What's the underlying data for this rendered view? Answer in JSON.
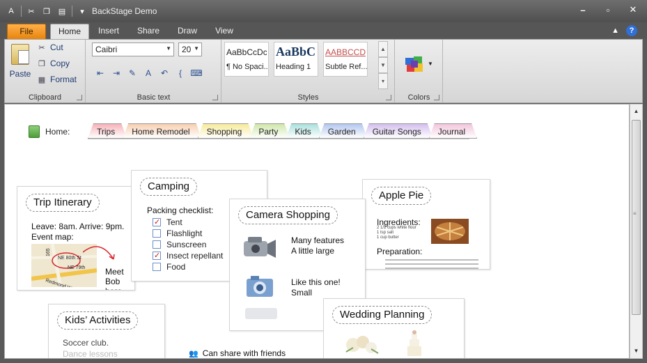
{
  "window": {
    "title": "BackStage Demo"
  },
  "qat": {
    "icons": [
      "app-icon",
      "cut-icon",
      "copy-icon",
      "paste-icon",
      "customize-icon"
    ]
  },
  "tabs": [
    "File",
    "Home",
    "Insert",
    "Share",
    "Draw",
    "View"
  ],
  "ribbon": {
    "clipboard": {
      "paste": "Paste",
      "cut": "Cut",
      "copy": "Copy",
      "format": "Format",
      "label": "Clipboard"
    },
    "basic_text": {
      "font": "Caibri",
      "size": "20",
      "label": "Basic text"
    },
    "styles": {
      "items": [
        {
          "preview": "AaBbCcDc",
          "name": "¶ No Spaci..."
        },
        {
          "preview": "AaBbC",
          "name": "Heading 1"
        },
        {
          "preview": "AABBCCDD",
          "name": "Subtle Ref..."
        }
      ],
      "label": "Styles"
    },
    "colors": {
      "label": "Colors"
    }
  },
  "notebook": {
    "home_label": "Home:",
    "sections": [
      {
        "name": "Trips",
        "color": "#f6b3b9"
      },
      {
        "name": "Home Remodel",
        "color": "#f8cfb0"
      },
      {
        "name": "Shopping",
        "color": "#f7ea9a"
      },
      {
        "name": "Party",
        "color": "#cfe7a9"
      },
      {
        "name": "Kids",
        "color": "#a9e0dd"
      },
      {
        "name": "Garden",
        "color": "#b3c7ef"
      },
      {
        "name": "Guitar Songs",
        "color": "#d5bfee"
      },
      {
        "name": "Journal",
        "color": "#f1c6db"
      }
    ]
  },
  "pages": {
    "trip": {
      "title": "Trip Itinerary",
      "line1": "Leave: 8am. Arrive: 9pm.",
      "line2": "Event map:",
      "map_labels": [
        "NE 80th St",
        "NE 79th",
        "Redmond Way",
        "165"
      ],
      "note": [
        "Meet",
        "Bob",
        "here"
      ]
    },
    "camping": {
      "title": "Camping",
      "subtitle": "Packing checklist:",
      "items": [
        {
          "label": "Tent",
          "checked": true
        },
        {
          "label": "Flashlight",
          "checked": false
        },
        {
          "label": "Sunscreen",
          "checked": false
        },
        {
          "label": "Insect repellant",
          "checked": true
        },
        {
          "label": "Food",
          "checked": false
        }
      ]
    },
    "camera": {
      "title": "Camera Shopping",
      "note1": [
        "Many features",
        "A little large"
      ],
      "note2": [
        "Like this one!",
        "Small"
      ]
    },
    "pie": {
      "title": "Apple Pie",
      "ingredients": "Ingredients:",
      "preparation": "Preparation:",
      "ingredient_lines": [
        "2 1/2 cups white flour",
        "1 tsp salt",
        "1 cup butter"
      ]
    },
    "kids": {
      "title": "Kids’ Activities",
      "line1": "Soccer club.",
      "line2": "Dance lessons"
    },
    "wedding": {
      "title": "Wedding Planning"
    },
    "share_note": "Can share with friends"
  }
}
